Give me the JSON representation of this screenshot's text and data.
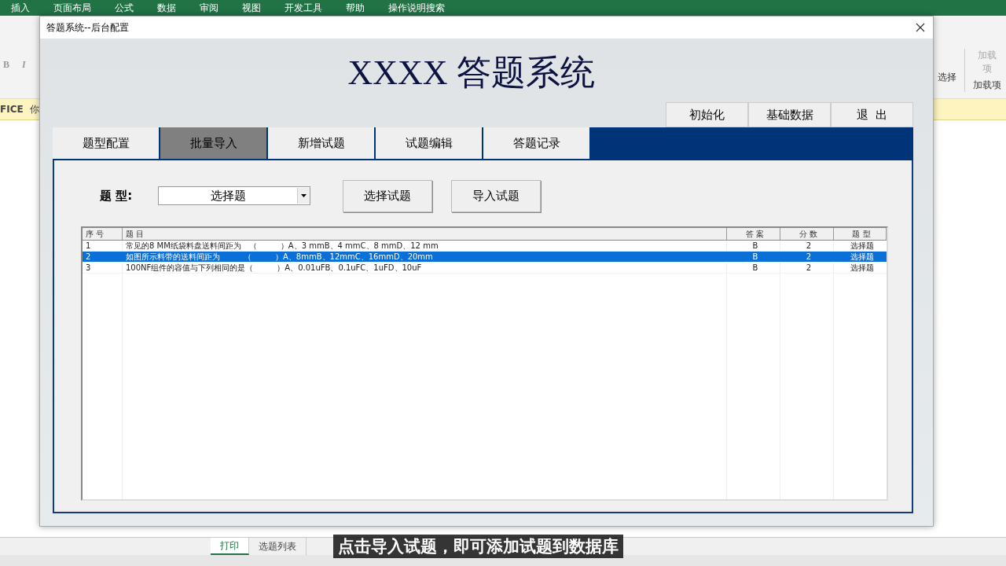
{
  "excel": {
    "menu": [
      "插入",
      "页面布局",
      "公式",
      "数据",
      "审阅",
      "视图",
      "开发工具",
      "帮助",
      "操作说明搜索"
    ],
    "ribbon_left": [
      "B",
      "I"
    ],
    "ribbon_right": {
      "command": "选择",
      "addin_button": "加载项",
      "group_label": "加载项"
    },
    "message_bar": [
      "FICE",
      "你"
    ],
    "sheet_tabs": [
      {
        "label": "打印",
        "selected": true
      },
      {
        "label": "选题列表",
        "selected": false
      }
    ]
  },
  "dialog": {
    "title": "答题系统--后台配置",
    "heading": "XXXX 答题系统",
    "top_buttons": [
      "初始化",
      "基础数据",
      "退  出"
    ],
    "tabs": [
      {
        "label": "题型配置",
        "selected": false
      },
      {
        "label": "批量导入",
        "selected": true
      },
      {
        "label": "新增试题",
        "selected": false
      },
      {
        "label": "试题编辑",
        "selected": false
      },
      {
        "label": "答题记录",
        "selected": false
      }
    ],
    "form": {
      "type_label": "题 型:",
      "type_value": "选择题"
    },
    "buttons": [
      "选择试题",
      "导入试题"
    ],
    "list": {
      "columns": [
        "序 号",
        "题 目",
        "答 案",
        "分 数",
        "题 型"
      ],
      "rows": [
        {
          "cells": [
            "1",
            "常见的8 MM纸袋料盘送料间距为　（　　　）A、3 mmB、4 mmC、8 mmD、12 mm",
            "B",
            "2",
            "选择题"
          ],
          "selected": false
        },
        {
          "cells": [
            "2",
            "如图所示料带的送料间距为　　　（　　　）A、8mmB、12mmC、16mmD、20mm",
            "B",
            "2",
            "选择题"
          ],
          "selected": true
        },
        {
          "cells": [
            "3",
            "100NF组件的容值与下列相同的是（　　　）A、0.01uFB、0.1uFC、1uFD、10uF",
            "B",
            "2",
            "选择题"
          ],
          "selected": false
        }
      ]
    }
  },
  "caption": "点击导入试题，即可添加试题到数据库"
}
